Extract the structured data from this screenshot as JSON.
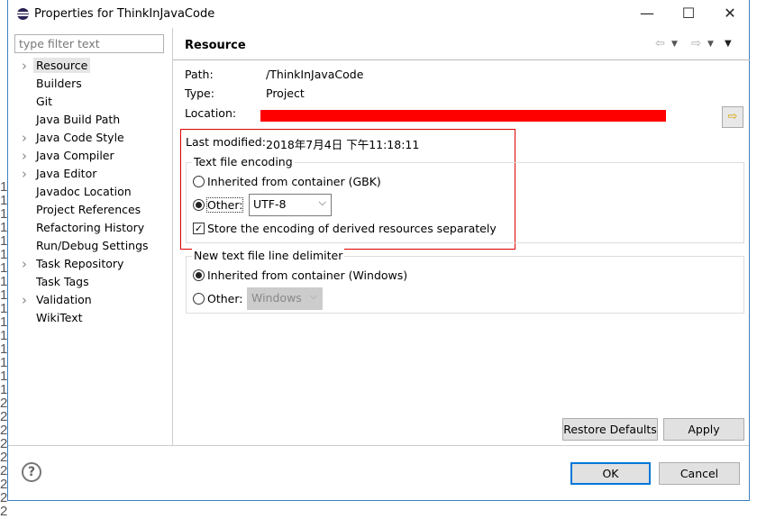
{
  "window": {
    "title": "Properties for ThinkInJavaCode",
    "minimize": "—",
    "maximize": "☐",
    "close": "✕"
  },
  "filter": {
    "placeholder": "type filter text"
  },
  "tree": [
    {
      "label": "Resource",
      "expandable": true,
      "selected": true
    },
    {
      "label": "Builders",
      "expandable": false
    },
    {
      "label": "Git",
      "expandable": false
    },
    {
      "label": "Java Build Path",
      "expandable": false
    },
    {
      "label": "Java Code Style",
      "expandable": true
    },
    {
      "label": "Java Compiler",
      "expandable": true
    },
    {
      "label": "Java Editor",
      "expandable": true
    },
    {
      "label": "Javadoc Location",
      "expandable": false
    },
    {
      "label": "Project References",
      "expandable": false
    },
    {
      "label": "Refactoring History",
      "expandable": false
    },
    {
      "label": "Run/Debug Settings",
      "expandable": false
    },
    {
      "label": "Task Repository",
      "expandable": true
    },
    {
      "label": "Task Tags",
      "expandable": false
    },
    {
      "label": "Validation",
      "expandable": true
    },
    {
      "label": "WikiText",
      "expandable": false
    }
  ],
  "page": {
    "title": "Resource",
    "path_label": "Path:",
    "path_value": "/ThinkInJavaCode",
    "type_label": "Type:",
    "type_value": "Project",
    "location_label": "Location:",
    "modified_label": "Last modified:",
    "modified_value": "2018年7月4日 下午11:18:11",
    "encoding": {
      "title": "Text file encoding",
      "inherited": "Inherited from container (GBK)",
      "other": "Other:",
      "other_value": "UTF-8",
      "store_derived": "Store the encoding of derived resources separately",
      "selected": "other",
      "store_checked": true
    },
    "delimiter": {
      "title": "New text file line delimiter",
      "inherited": "Inherited from container (Windows)",
      "other": "Other:",
      "other_value": "Windows",
      "selected": "inherited"
    }
  },
  "buttons": {
    "restore": "Restore Defaults",
    "apply": "Apply",
    "ok": "OK",
    "cancel": "Cancel",
    "help": "?"
  },
  "background_line_numbers": [
    "1",
    "1",
    "1",
    "1",
    "1",
    "1",
    "1",
    "1",
    "1",
    "1",
    "1",
    "1",
    "1",
    "1",
    "1",
    "1",
    "2",
    "2",
    "2",
    "2",
    "2",
    "2",
    "2",
    "2",
    "2"
  ],
  "colors": {
    "highlight_box": "#dd0000",
    "redaction": "#ff0000",
    "default_button_border": "#0078d7"
  }
}
